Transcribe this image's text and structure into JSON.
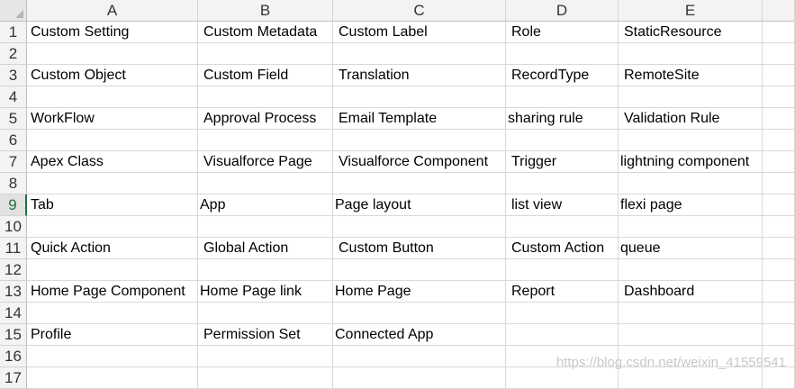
{
  "columns": [
    "A",
    "B",
    "C",
    "D",
    "E"
  ],
  "rows": [
    {
      "num": "1",
      "cells": [
        "Custom Setting",
        "Custom Metadata",
        "Custom Label",
        "Role",
        "StaticResource"
      ],
      "pad": [
        4,
        6,
        6,
        6,
        6
      ]
    },
    {
      "num": "2",
      "cells": [
        "",
        "",
        "",
        "",
        ""
      ],
      "pad": [
        4,
        4,
        4,
        4,
        4
      ]
    },
    {
      "num": "3",
      "cells": [
        "Custom Object",
        "Custom Field",
        "Translation",
        "RecordType",
        "RemoteSite"
      ],
      "pad": [
        4,
        6,
        6,
        6,
        6
      ]
    },
    {
      "num": "4",
      "cells": [
        "",
        "",
        "",
        "",
        ""
      ],
      "pad": [
        4,
        4,
        4,
        4,
        4
      ]
    },
    {
      "num": "5",
      "cells": [
        "WorkFlow",
        "Approval Process",
        "Email Template",
        "sharing rule",
        "Validation Rule"
      ],
      "pad": [
        4,
        6,
        6,
        2,
        6
      ]
    },
    {
      "num": "6",
      "cells": [
        "",
        "",
        "",
        "",
        ""
      ],
      "pad": [
        4,
        4,
        4,
        4,
        4
      ]
    },
    {
      "num": "7",
      "cells": [
        "Apex Class",
        "Visualforce Page",
        "Visualforce Component",
        "Trigger",
        "lightning component"
      ],
      "pad": [
        4,
        6,
        6,
        6,
        2
      ]
    },
    {
      "num": "8",
      "cells": [
        "",
        "",
        "",
        "",
        ""
      ],
      "pad": [
        4,
        4,
        4,
        4,
        4
      ]
    },
    {
      "num": "9",
      "cells": [
        "Tab",
        "App",
        "Page layout",
        "list view",
        "flexi page"
      ],
      "pad": [
        4,
        2,
        2,
        6,
        2
      ]
    },
    {
      "num": "10",
      "cells": [
        "",
        "",
        "",
        "",
        ""
      ],
      "pad": [
        4,
        4,
        4,
        4,
        4
      ]
    },
    {
      "num": "11",
      "cells": [
        "Quick Action",
        "Global Action",
        "Custom Button",
        "Custom Action",
        "queue"
      ],
      "pad": [
        4,
        6,
        6,
        6,
        2
      ]
    },
    {
      "num": "12",
      "cells": [
        "",
        "",
        "",
        "",
        ""
      ],
      "pad": [
        4,
        4,
        4,
        4,
        4
      ]
    },
    {
      "num": "13",
      "cells": [
        "Home Page Component",
        "Home Page link",
        "Home Page",
        "Report",
        "Dashboard"
      ],
      "pad": [
        4,
        2,
        2,
        6,
        6
      ]
    },
    {
      "num": "14",
      "cells": [
        "",
        "",
        "",
        "",
        ""
      ],
      "pad": [
        4,
        4,
        4,
        4,
        4
      ]
    },
    {
      "num": "15",
      "cells": [
        "Profile",
        "Permission Set",
        "Connected App",
        "",
        ""
      ],
      "pad": [
        4,
        6,
        2,
        4,
        4
      ]
    },
    {
      "num": "16",
      "cells": [
        "",
        "",
        "",
        "",
        ""
      ],
      "pad": [
        4,
        4,
        4,
        4,
        4
      ]
    },
    {
      "num": "17",
      "cells": [
        "",
        "",
        "",
        "",
        ""
      ],
      "pad": [
        4,
        4,
        4,
        4,
        4
      ]
    }
  ],
  "active_row": "9",
  "watermark": "https://blog.csdn.net/weixin_41559541"
}
